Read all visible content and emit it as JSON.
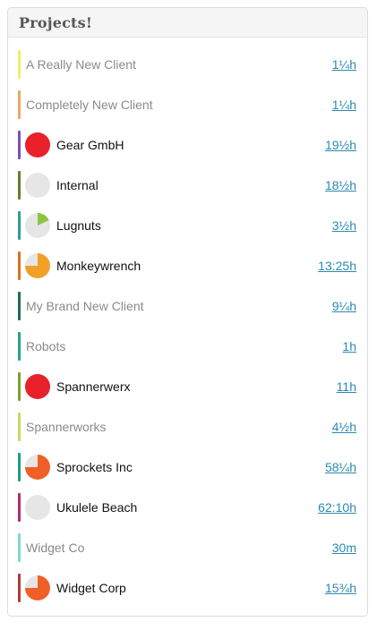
{
  "panel": {
    "title": "Projects!"
  },
  "colors": {
    "link": "#2a8ab0",
    "track": "#e6e6e6"
  },
  "projects": [
    {
      "name": "A Really New Client",
      "hours": "1¼h",
      "bar_color": "#f2ec6b",
      "pie": null
    },
    {
      "name": "Completely New Client",
      "hours": "1¼h",
      "bar_color": "#e9a767",
      "pie": null
    },
    {
      "name": "Gear GmbH",
      "hours": "19½h",
      "bar_color": "#7e4fb7",
      "pie": {
        "fraction": 1.0,
        "color": "#e8212b"
      }
    },
    {
      "name": "Internal",
      "hours": "18½h",
      "bar_color": "#6a7c2d",
      "pie": {
        "fraction": 0,
        "color": "#e6e6e6"
      }
    },
    {
      "name": "Lugnuts",
      "hours": "3½h",
      "bar_color": "#2f9c97",
      "pie": {
        "fraction": 0.18,
        "color": "#8cc63f"
      }
    },
    {
      "name": "Monkeywrench",
      "hours": "13:25h",
      "bar_color": "#d9731f",
      "pie": {
        "fraction": 0.75,
        "color": "#f2a028"
      }
    },
    {
      "name": "My Brand New Client",
      "hours": "9¼h",
      "bar_color": "#1e6a5a",
      "pie": null
    },
    {
      "name": "Robots",
      "hours": "1h",
      "bar_color": "#2aa08a",
      "pie": null
    },
    {
      "name": "Spannerwerx",
      "hours": "11h",
      "bar_color": "#7ea12c",
      "pie": {
        "fraction": 1.0,
        "color": "#e8212b"
      }
    },
    {
      "name": "Spannerworks",
      "hours": "4½h",
      "bar_color": "#c7da63",
      "pie": null
    },
    {
      "name": "Sprockets Inc",
      "hours": "58¼h",
      "bar_color": "#1f9b86",
      "pie": {
        "fraction": 0.75,
        "color": "#f05f27"
      }
    },
    {
      "name": "Ukulele Beach",
      "hours": "62:10h",
      "bar_color": "#b02e6e",
      "pie": {
        "fraction": 0,
        "color": "#e6e6e6"
      }
    },
    {
      "name": "Widget Co",
      "hours": "30m",
      "bar_color": "#7fd8cd",
      "pie": null
    },
    {
      "name": "Widget Corp",
      "hours": "15¾h",
      "bar_color": "#b23a3a",
      "pie": {
        "fraction": 0.75,
        "color": "#f05f27"
      }
    }
  ]
}
